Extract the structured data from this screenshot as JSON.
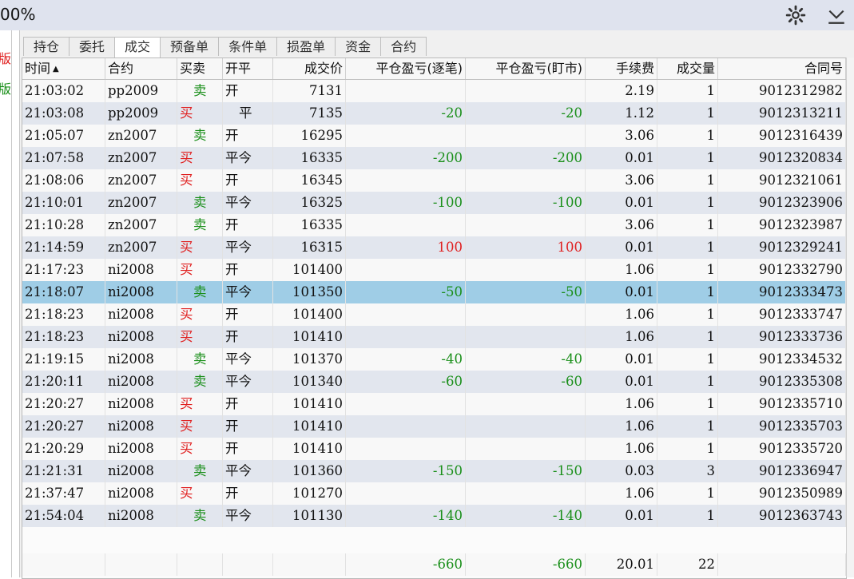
{
  "titlebar": {
    "zoom": "00%",
    "settings_icon": "gear-icon",
    "collapse_icon": "chevron-down-icon"
  },
  "left_edge": {
    "top_text": "版",
    "bottom_text": "版"
  },
  "tabs": [
    "持仓",
    "委托",
    "成交",
    "预备单",
    "条件单",
    "损盈单",
    "资金",
    "合约"
  ],
  "active_tab": "成交",
  "columns": [
    "时间",
    "合约",
    "买卖",
    "开平",
    "成交价",
    "平仓盈亏(逐笔)",
    "平仓盈亏(盯市)",
    "手续费",
    "成交量",
    "合同号"
  ],
  "sort_indicator": "▲",
  "rows": [
    {
      "time": "21:03:02",
      "contract": "pp2009",
      "side": "卖",
      "oc": "开",
      "price": "7131",
      "pnl_trade": "",
      "pnl_mark": "",
      "fee": "2.19",
      "vol": "1",
      "order_no": "9012312982"
    },
    {
      "time": "21:03:08",
      "contract": "pp2009",
      "side": "买",
      "oc": "平",
      "price": "7135",
      "pnl_trade": "-20",
      "pnl_mark": "-20",
      "fee": "1.12",
      "vol": "1",
      "order_no": "9012313211"
    },
    {
      "time": "21:05:07",
      "contract": "zn2007",
      "side": "卖",
      "oc": "开",
      "price": "16295",
      "pnl_trade": "",
      "pnl_mark": "",
      "fee": "3.06",
      "vol": "1",
      "order_no": "9012316439"
    },
    {
      "time": "21:07:58",
      "contract": "zn2007",
      "side": "买",
      "oc": "平今",
      "price": "16335",
      "pnl_trade": "-200",
      "pnl_mark": "-200",
      "fee": "0.01",
      "vol": "1",
      "order_no": "9012320834"
    },
    {
      "time": "21:08:06",
      "contract": "zn2007",
      "side": "买",
      "oc": "开",
      "price": "16345",
      "pnl_trade": "",
      "pnl_mark": "",
      "fee": "3.06",
      "vol": "1",
      "order_no": "9012321061"
    },
    {
      "time": "21:10:01",
      "contract": "zn2007",
      "side": "卖",
      "oc": "平今",
      "price": "16325",
      "pnl_trade": "-100",
      "pnl_mark": "-100",
      "fee": "0.01",
      "vol": "1",
      "order_no": "9012323906"
    },
    {
      "time": "21:10:28",
      "contract": "zn2007",
      "side": "卖",
      "oc": "开",
      "price": "16335",
      "pnl_trade": "",
      "pnl_mark": "",
      "fee": "3.06",
      "vol": "1",
      "order_no": "9012323987"
    },
    {
      "time": "21:14:59",
      "contract": "zn2007",
      "side": "买",
      "oc": "平今",
      "price": "16315",
      "pnl_trade": "100",
      "pnl_mark": "100",
      "fee": "0.01",
      "vol": "1",
      "order_no": "9012329241"
    },
    {
      "time": "21:17:23",
      "contract": "ni2008",
      "side": "买",
      "oc": "开",
      "price": "101400",
      "pnl_trade": "",
      "pnl_mark": "",
      "fee": "1.06",
      "vol": "1",
      "order_no": "9012332790"
    },
    {
      "time": "21:18:07",
      "contract": "ni2008",
      "side": "卖",
      "oc": "平今",
      "price": "101350",
      "pnl_trade": "-50",
      "pnl_mark": "-50",
      "fee": "0.01",
      "vol": "1",
      "order_no": "9012333473"
    },
    {
      "time": "21:18:23",
      "contract": "ni2008",
      "side": "买",
      "oc": "开",
      "price": "101400",
      "pnl_trade": "",
      "pnl_mark": "",
      "fee": "1.06",
      "vol": "1",
      "order_no": "9012333747"
    },
    {
      "time": "21:18:23",
      "contract": "ni2008",
      "side": "买",
      "oc": "开",
      "price": "101410",
      "pnl_trade": "",
      "pnl_mark": "",
      "fee": "1.06",
      "vol": "1",
      "order_no": "9012333736"
    },
    {
      "time": "21:19:15",
      "contract": "ni2008",
      "side": "卖",
      "oc": "平今",
      "price": "101370",
      "pnl_trade": "-40",
      "pnl_mark": "-40",
      "fee": "0.01",
      "vol": "1",
      "order_no": "9012334532"
    },
    {
      "time": "21:20:11",
      "contract": "ni2008",
      "side": "卖",
      "oc": "平今",
      "price": "101340",
      "pnl_trade": "-60",
      "pnl_mark": "-60",
      "fee": "0.01",
      "vol": "1",
      "order_no": "9012335308"
    },
    {
      "time": "21:20:27",
      "contract": "ni2008",
      "side": "买",
      "oc": "开",
      "price": "101410",
      "pnl_trade": "",
      "pnl_mark": "",
      "fee": "1.06",
      "vol": "1",
      "order_no": "9012335710"
    },
    {
      "time": "21:20:27",
      "contract": "ni2008",
      "side": "买",
      "oc": "开",
      "price": "101410",
      "pnl_trade": "",
      "pnl_mark": "",
      "fee": "1.06",
      "vol": "1",
      "order_no": "9012335703"
    },
    {
      "time": "21:20:29",
      "contract": "ni2008",
      "side": "买",
      "oc": "开",
      "price": "101410",
      "pnl_trade": "",
      "pnl_mark": "",
      "fee": "1.06",
      "vol": "1",
      "order_no": "9012335720"
    },
    {
      "time": "21:21:31",
      "contract": "ni2008",
      "side": "卖",
      "oc": "平今",
      "price": "101360",
      "pnl_trade": "-150",
      "pnl_mark": "-150",
      "fee": "0.03",
      "vol": "3",
      "order_no": "9012336947"
    },
    {
      "time": "21:37:47",
      "contract": "ni2008",
      "side": "买",
      "oc": "开",
      "price": "101270",
      "pnl_trade": "",
      "pnl_mark": "",
      "fee": "1.06",
      "vol": "1",
      "order_no": "9012350989"
    },
    {
      "time": "21:54:04",
      "contract": "ni2008",
      "side": "卖",
      "oc": "平今",
      "price": "101130",
      "pnl_trade": "-140",
      "pnl_mark": "-140",
      "fee": "0.01",
      "vol": "1",
      "order_no": "9012363743"
    }
  ],
  "selected_row_index": 9,
  "totals": {
    "pnl_trade": "-660",
    "pnl_mark": "-660",
    "fee": "20.01",
    "vol": "22"
  }
}
